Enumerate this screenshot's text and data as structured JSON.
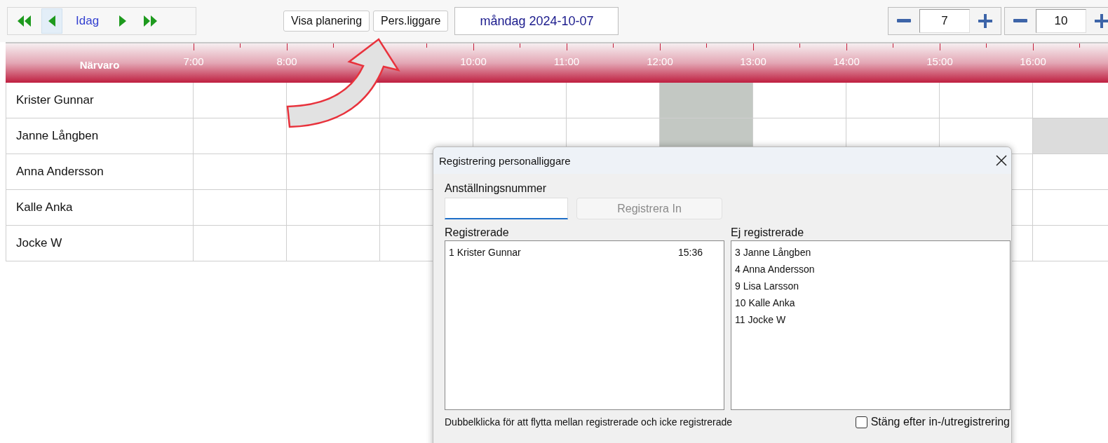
{
  "toolbar": {
    "nav_buttons": [
      {
        "kind": "first",
        "selected": false
      },
      {
        "kind": "prev",
        "selected": true
      },
      {
        "kind": "today",
        "label": "Idag",
        "selected": false
      },
      {
        "kind": "next",
        "selected": false
      },
      {
        "kind": "last",
        "selected": false
      }
    ],
    "buttons": [
      "Visa planering",
      "Pers.liggare"
    ],
    "date": "måndag 2024-10-07",
    "spinners": [
      {
        "value": "7"
      },
      {
        "value": "10"
      }
    ]
  },
  "schedule": {
    "header_label": "Närvaro",
    "columns": [
      {
        "label": "7:00"
      },
      {
        "label": "8:00"
      },
      {},
      {
        "label": "10:00"
      },
      {
        "label": "11:00"
      },
      {
        "label": "12:00"
      },
      {
        "label": "13:00"
      },
      {
        "label": "14:00"
      },
      {
        "label": "15:00"
      },
      {
        "label": "16:00"
      }
    ],
    "rows": [
      {
        "name": "Krister Gunnar",
        "cells": [
          {
            "kind": "empty"
          },
          {
            "kind": "empty"
          },
          {
            "kind": "empty"
          },
          {
            "kind": "empty"
          },
          {
            "kind": "empty"
          },
          {
            "kind": "planned"
          },
          {
            "kind": "empty"
          },
          {
            "kind": "empty"
          },
          {
            "kind": "empty"
          },
          {
            "kind": "empty"
          }
        ]
      },
      {
        "name": "Janne Långben",
        "cells": [
          {
            "kind": "empty"
          },
          {
            "kind": "empty"
          },
          {
            "kind": "empty"
          },
          {
            "kind": "empty"
          },
          {
            "kind": "empty"
          },
          {
            "kind": "planned"
          },
          {
            "kind": "empty"
          },
          {
            "kind": "empty"
          },
          {
            "kind": "empty"
          },
          {
            "kind": "absent"
          }
        ]
      },
      {
        "name": "Anna Andersson",
        "cells": [
          {
            "kind": "empty"
          },
          {
            "kind": "empty"
          },
          {
            "kind": "empty"
          },
          {},
          {},
          {},
          {},
          {},
          {
            "kind": "empty"
          },
          {
            "kind": "empty"
          }
        ]
      },
      {
        "name": "Kalle Anka",
        "cells": [
          {
            "kind": "empty"
          },
          {
            "kind": "empty"
          },
          {
            "kind": "empty"
          },
          {},
          {},
          {},
          {},
          {},
          {
            "kind": "empty"
          },
          {
            "kind": "empty"
          }
        ]
      },
      {
        "name": "Jocke W",
        "cells": [
          {
            "kind": "empty"
          },
          {
            "kind": "empty"
          },
          {
            "kind": "empty"
          },
          {},
          {},
          {},
          {},
          {},
          {
            "kind": "empty"
          },
          {
            "kind": "empty"
          }
        ]
      }
    ]
  },
  "dialog": {
    "title": "Registrering personalliggare",
    "field_label": "Anställningsnummer",
    "register_button": {
      "label": "Registrera In",
      "disabled": true
    },
    "registered": {
      "label": "Registrerade",
      "items": [
        {
          "name": "1 Krister Gunnar",
          "time": "15:36"
        }
      ]
    },
    "not_registered": {
      "label": "Ej registrerade",
      "items": [
        {
          "name": "3 Janne Långben"
        },
        {
          "name": "4 Anna Andersson"
        },
        {
          "name": "9 Lisa Larsson"
        },
        {
          "name": "10 Kalle Anka"
        },
        {
          "name": "11 Jocke W"
        }
      ]
    },
    "hint": "Dubbelklicka för att flytta mellan registrerade och icke registrerade",
    "close_checkbox": {
      "label": "Stäng efter in-/utregistrering",
      "checked": false
    }
  }
}
